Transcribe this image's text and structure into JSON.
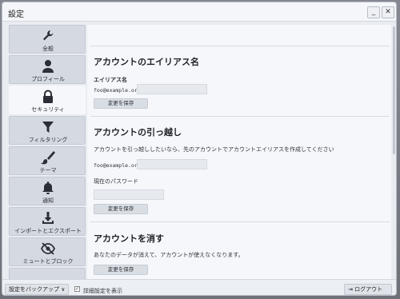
{
  "window": {
    "title": "設定",
    "minimize_label": "_",
    "close_label": "✕"
  },
  "sidebar": {
    "items": [
      {
        "label": "全般",
        "icon": "wrench-icon"
      },
      {
        "label": "プロフィール",
        "icon": "person-icon"
      },
      {
        "label": "セキュリティ",
        "icon": "lock-icon",
        "active": true
      },
      {
        "label": "フィルタリング",
        "icon": "funnel-icon"
      },
      {
        "label": "テーマ",
        "icon": "paintbrush-icon"
      },
      {
        "label": "通知",
        "icon": "bell-icon"
      },
      {
        "label": "インポートとエクスポート",
        "icon": "download-icon"
      },
      {
        "label": "ミュートとブロック",
        "icon": "eye-slash-icon"
      }
    ]
  },
  "alias": {
    "heading": "アカウントのエイリアス名",
    "field_label": "エイリアス名",
    "prefix": "foo@example.org",
    "save": "変更を保存"
  },
  "move": {
    "heading": "アカウントの引っ越し",
    "description": "アカウントを引っ越ししたいなら、先のアカウントでアカウントエイリアスを作成してください",
    "prefix": "foo@example.org",
    "password_label": "現在のパスワード",
    "save": "変更を保存"
  },
  "delete": {
    "heading": "アカウントを消す",
    "description": "あなたのデータが消えて、アカウントが使えなくなります。",
    "save": "変更を保存"
  },
  "footer": {
    "backup": "設定をバックアップ ∨",
    "checkbox_mark": "✓",
    "advanced": "詳細設定を表示",
    "logout": "ログアウト"
  }
}
